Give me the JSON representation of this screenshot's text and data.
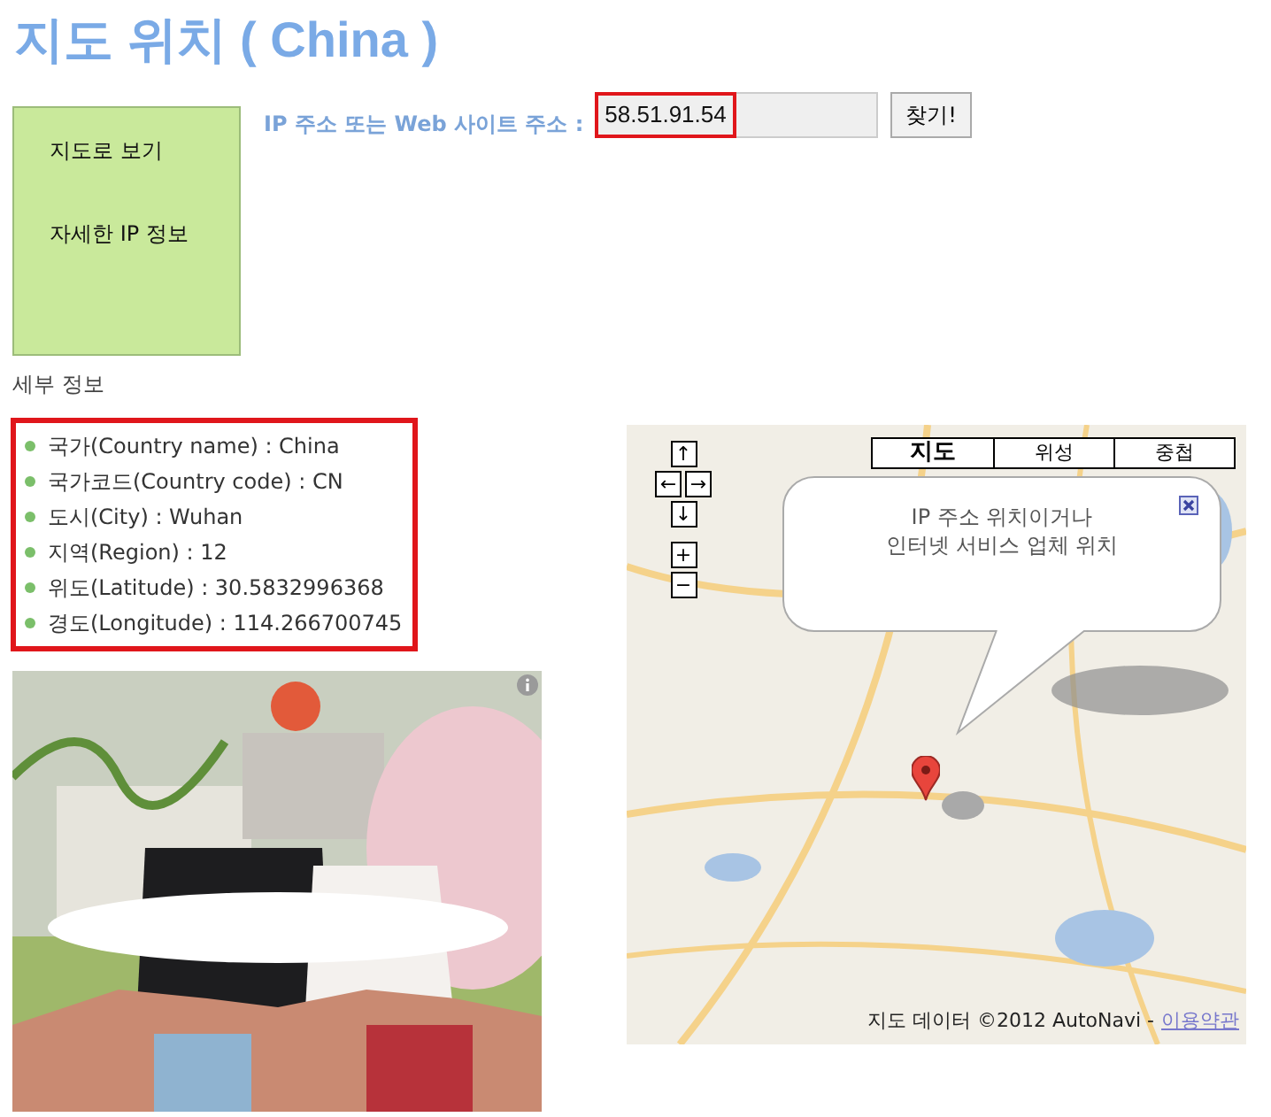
{
  "title": "지도 위치 ( China )",
  "side_menu": [
    {
      "label": "지도로 보기"
    },
    {
      "label": "자세한 IP 정보"
    }
  ],
  "search": {
    "label": "IP 주소 또는 Web 사이트 주소 :",
    "value": "58.51.91.54",
    "button": "찾기!"
  },
  "details": {
    "heading": "세부 정보",
    "items": [
      "국가(Country name) : China",
      "국가코드(Country code) : CN",
      "도시(City) : Wuhan",
      "지역(Region) : 12",
      "위도(Latitude) : 30.5832996368",
      "경도(Longitude) : 114.266700745"
    ]
  },
  "map": {
    "nav_buttons": [
      {
        "kind": "up",
        "label": "↑"
      },
      {
        "kind": "left",
        "label": "←"
      },
      {
        "kind": "right",
        "label": "→"
      },
      {
        "kind": "down",
        "label": "↓"
      },
      {
        "kind": "zoom_in",
        "label": "+"
      },
      {
        "kind": "zoom_out",
        "label": "−"
      }
    ],
    "tabs": [
      {
        "label": "지도",
        "selected": true
      },
      {
        "label": "위성",
        "selected": false
      },
      {
        "label": "중첩",
        "selected": false
      }
    ],
    "info_bubble": {
      "lines": [
        "IP 주소 위치이거나",
        "인터넷 서비스 업체 위치"
      ]
    },
    "attribution": "지도 데이터 ©2012 AutoNavi -",
    "terms_link": "이용약관"
  }
}
